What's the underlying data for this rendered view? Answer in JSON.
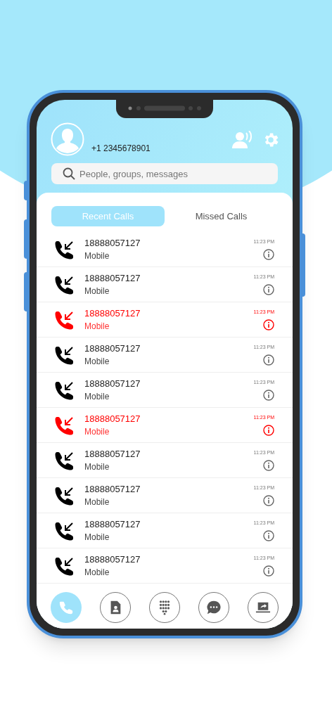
{
  "profile": {
    "phone": "+1 2345678901"
  },
  "search": {
    "placeholder": "People, groups, messages"
  },
  "tabs": [
    {
      "label": "Recent Calls",
      "selected": true
    },
    {
      "label": "Missed Calls",
      "selected": false
    }
  ],
  "calls": [
    {
      "number": "18888057127",
      "type": "Mobile",
      "time": "11:23 PM",
      "kind": "incoming"
    },
    {
      "number": "18888057127",
      "type": "Mobile",
      "time": "11:23 PM",
      "kind": "incoming"
    },
    {
      "number": "18888057127",
      "type": "Mobile",
      "time": "11:23 PM",
      "kind": "missed"
    },
    {
      "number": "18888057127",
      "type": "Mobile",
      "time": "11:23 PM",
      "kind": "incoming"
    },
    {
      "number": "18888057127",
      "type": "Mobile",
      "time": "11:23 PM",
      "kind": "incoming"
    },
    {
      "number": "18888057127",
      "type": "Mobile",
      "time": "11:23 PM",
      "kind": "missed"
    },
    {
      "number": "18888057127",
      "type": "Mobile",
      "time": "11:23 PM",
      "kind": "incoming"
    },
    {
      "number": "18888057127",
      "type": "Mobile",
      "time": "11:23 PM",
      "kind": "incoming"
    },
    {
      "number": "18888057127",
      "type": "Mobile",
      "time": "11:23 PM",
      "kind": "incoming"
    },
    {
      "number": "18888057127",
      "type": "Mobile",
      "time": "11:23 PM",
      "kind": "incoming"
    }
  ],
  "nav": [
    {
      "kind": "calls",
      "selected": true
    },
    {
      "kind": "contacts",
      "selected": false
    },
    {
      "kind": "dialpad",
      "selected": false
    },
    {
      "kind": "messages",
      "selected": false
    },
    {
      "kind": "share",
      "selected": false
    }
  ]
}
